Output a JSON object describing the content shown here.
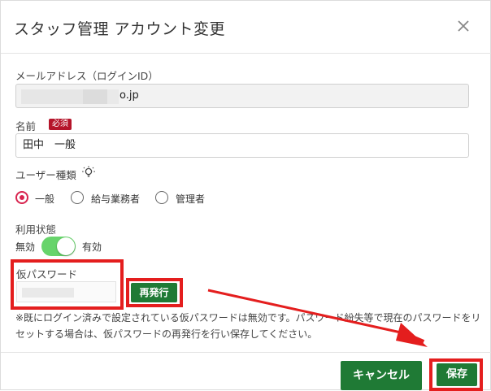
{
  "dialog": {
    "title": "スタッフ管理 アカウント変更"
  },
  "email": {
    "label": "メールアドレス（ログインID）",
    "value_visible": "o.jp"
  },
  "name": {
    "label": "名前",
    "required_badge": "必須",
    "value": "田中　一般"
  },
  "user_type": {
    "label": "ユーザー種類",
    "icon": "lightbulb-icon",
    "options": [
      "一般",
      "給与業務者",
      "管理者"
    ],
    "selected": "一般"
  },
  "status": {
    "label": "利用状態",
    "off_label": "無効",
    "on_label": "有効",
    "enabled": true
  },
  "temp_password": {
    "label": "仮パスワード",
    "reissue_button": "再発行"
  },
  "note": "※既にログイン済みで設定されている仮パスワードは無効です。パスワード紛失等で現在のパスワードをリセットする場合は、仮パスワードの再発行を行い保存してください。",
  "footer": {
    "cancel_button": "キャンセル",
    "save_button": "保存"
  },
  "colors": {
    "accent_green": "#1f7a35",
    "highlight_red": "#e41e1e",
    "toggle_on": "#67d46b",
    "radio_selected": "#d8244f",
    "badge_red": "#b5142a"
  }
}
